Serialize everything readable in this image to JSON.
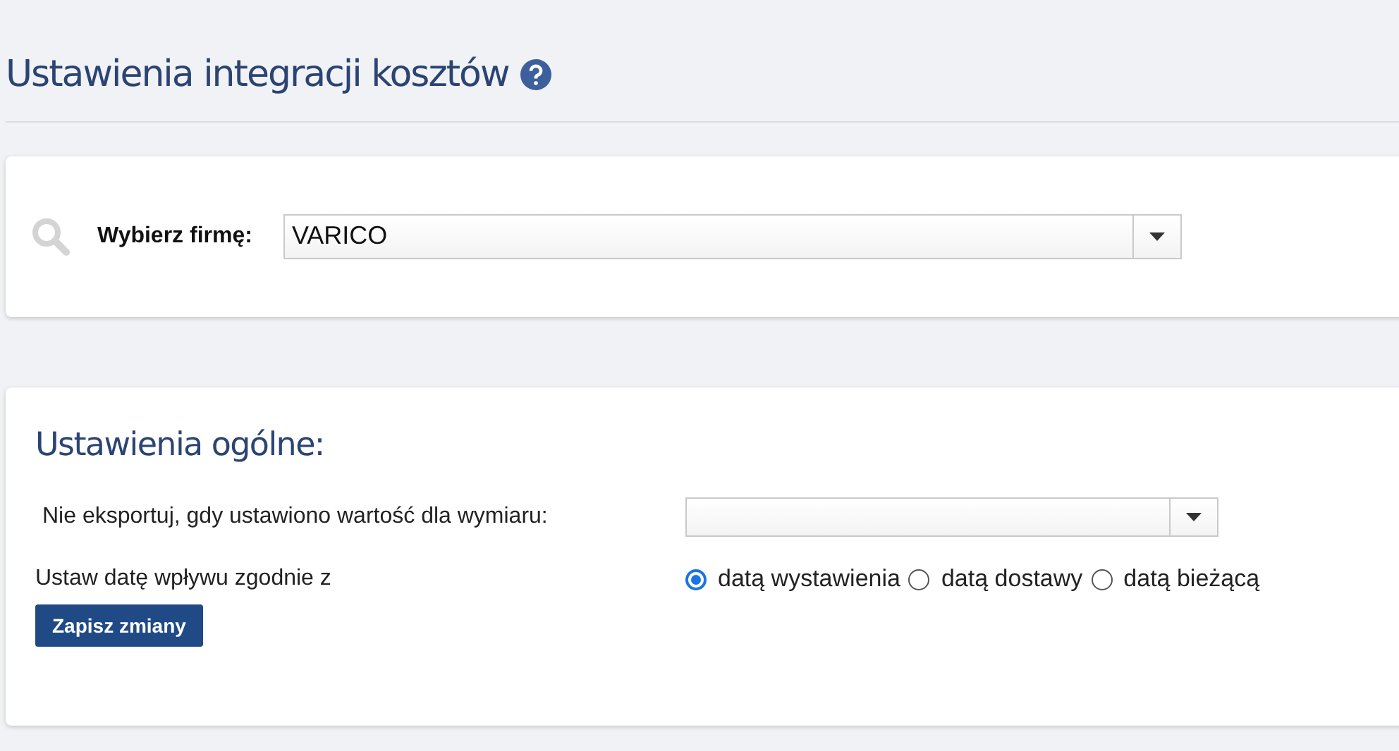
{
  "page_title": "Ustawienia integracji kosztów",
  "company_select": {
    "label": "Wybierz firmę:",
    "value": "VARICO"
  },
  "general_settings": {
    "title": "Ustawienia ogólne:",
    "dimension_select": {
      "label": "Nie eksportuj, gdy ustawiono wartość dla wymiaru:"
    },
    "date_option": {
      "label": "Ustaw datę wpływu zgodnie z",
      "options": [
        {
          "label": "datą wystawienia",
          "selected": true
        },
        {
          "label": "datą dostawy",
          "selected": false
        },
        {
          "label": "datą bieżącą",
          "selected": false
        }
      ]
    },
    "save_button": "Zapisz zmiany"
  }
}
